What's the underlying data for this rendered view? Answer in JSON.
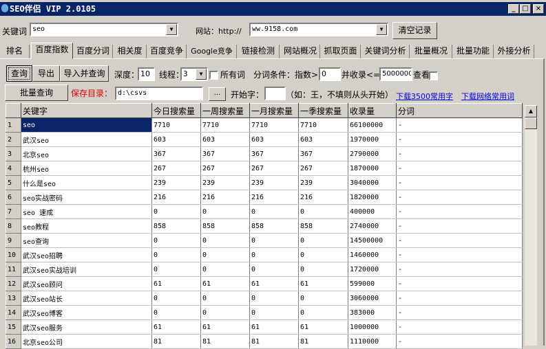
{
  "window": {
    "title": "SEO伴侣 VIP 2.0105",
    "min": "_",
    "max": "□",
    "close": "×"
  },
  "top": {
    "keyword_label": "关键词",
    "keyword_value": "seo",
    "site_label": "网站：http://",
    "site_value": "ww.9158.com",
    "clear_button": "清空记录"
  },
  "tabs": [
    "排名",
    "百度指数",
    "百度分词",
    "相关度",
    "百度竞争",
    "Google竞争",
    "链接检测",
    "网站概况",
    "抓取页面",
    "关键词分析",
    "批量概况",
    "批量功能",
    "外接分析"
  ],
  "selected_tab": "百度指数",
  "toolbar": {
    "query": "查询",
    "export": "导出",
    "import_query": "导入并查询",
    "depth_label": "深度：",
    "depth_value": "10",
    "threads_label": "线程：",
    "threads_value": "3",
    "all_words": "所有词",
    "cond_label": "分词条件：指数>=",
    "index_min": "0",
    "index_label2": "并收录<=",
    "index_max": "5000000",
    "view_label": "查看",
    "batch_query": "批量查询",
    "save_dir_label": "保存目录：",
    "save_dir_value": "d:\\csvs",
    "browse": "...",
    "start_label": "开始字：",
    "start_value": "",
    "hint": "（如：王，不填则从头开始）",
    "link1": "下载3500常用字",
    "link2": "下载网络常用词"
  },
  "table": {
    "headers": [
      "",
      "关键字",
      "今日搜索量",
      "一周搜索量",
      "一月搜索量",
      "一季搜索量",
      "收录量",
      "分词"
    ],
    "rows": [
      [
        "1",
        "seo",
        "7710",
        "7710",
        "7710",
        "7710",
        "66100000",
        "-"
      ],
      [
        "2",
        "武汉seo",
        "603",
        "603",
        "603",
        "603",
        "1970000",
        "-"
      ],
      [
        "3",
        "北京seo",
        "367",
        "367",
        "367",
        "367",
        "2790000",
        "-"
      ],
      [
        "4",
        "杭州seo",
        "267",
        "267",
        "267",
        "267",
        "1870000",
        "-"
      ],
      [
        "5",
        "什么是seo",
        "239",
        "239",
        "239",
        "239",
        "3040000",
        "-"
      ],
      [
        "6",
        "seo实战密码",
        "216",
        "216",
        "216",
        "216",
        "1820000",
        "-"
      ],
      [
        "7",
        "seo 速成",
        "0",
        "0",
        "0",
        "0",
        "400000",
        "-"
      ],
      [
        "8",
        "seo教程",
        "858",
        "858",
        "858",
        "858",
        "2740000",
        "-"
      ],
      [
        "9",
        "seo查询",
        "0",
        "0",
        "0",
        "0",
        "14500000",
        "-"
      ],
      [
        "10",
        "武汉seo招聘",
        "0",
        "0",
        "0",
        "0",
        "1460000",
        "-"
      ],
      [
        "11",
        "武汉seo实战培训",
        "0",
        "0",
        "0",
        "0",
        "1720000",
        "-"
      ],
      [
        "12",
        "武汉seo顾问",
        "61",
        "61",
        "61",
        "61",
        "599000",
        "-"
      ],
      [
        "13",
        "武汉seo站长",
        "0",
        "0",
        "0",
        "0",
        "3060000",
        "-"
      ],
      [
        "14",
        "武汉seo博客",
        "0",
        "0",
        "0",
        "0",
        "383000",
        "-"
      ],
      [
        "15",
        "武汉seo服务",
        "61",
        "61",
        "61",
        "61",
        "1000000",
        "-"
      ],
      [
        "16",
        "北京seo公司",
        "81",
        "81",
        "81",
        "81",
        "1110000",
        "-"
      ]
    ]
  }
}
